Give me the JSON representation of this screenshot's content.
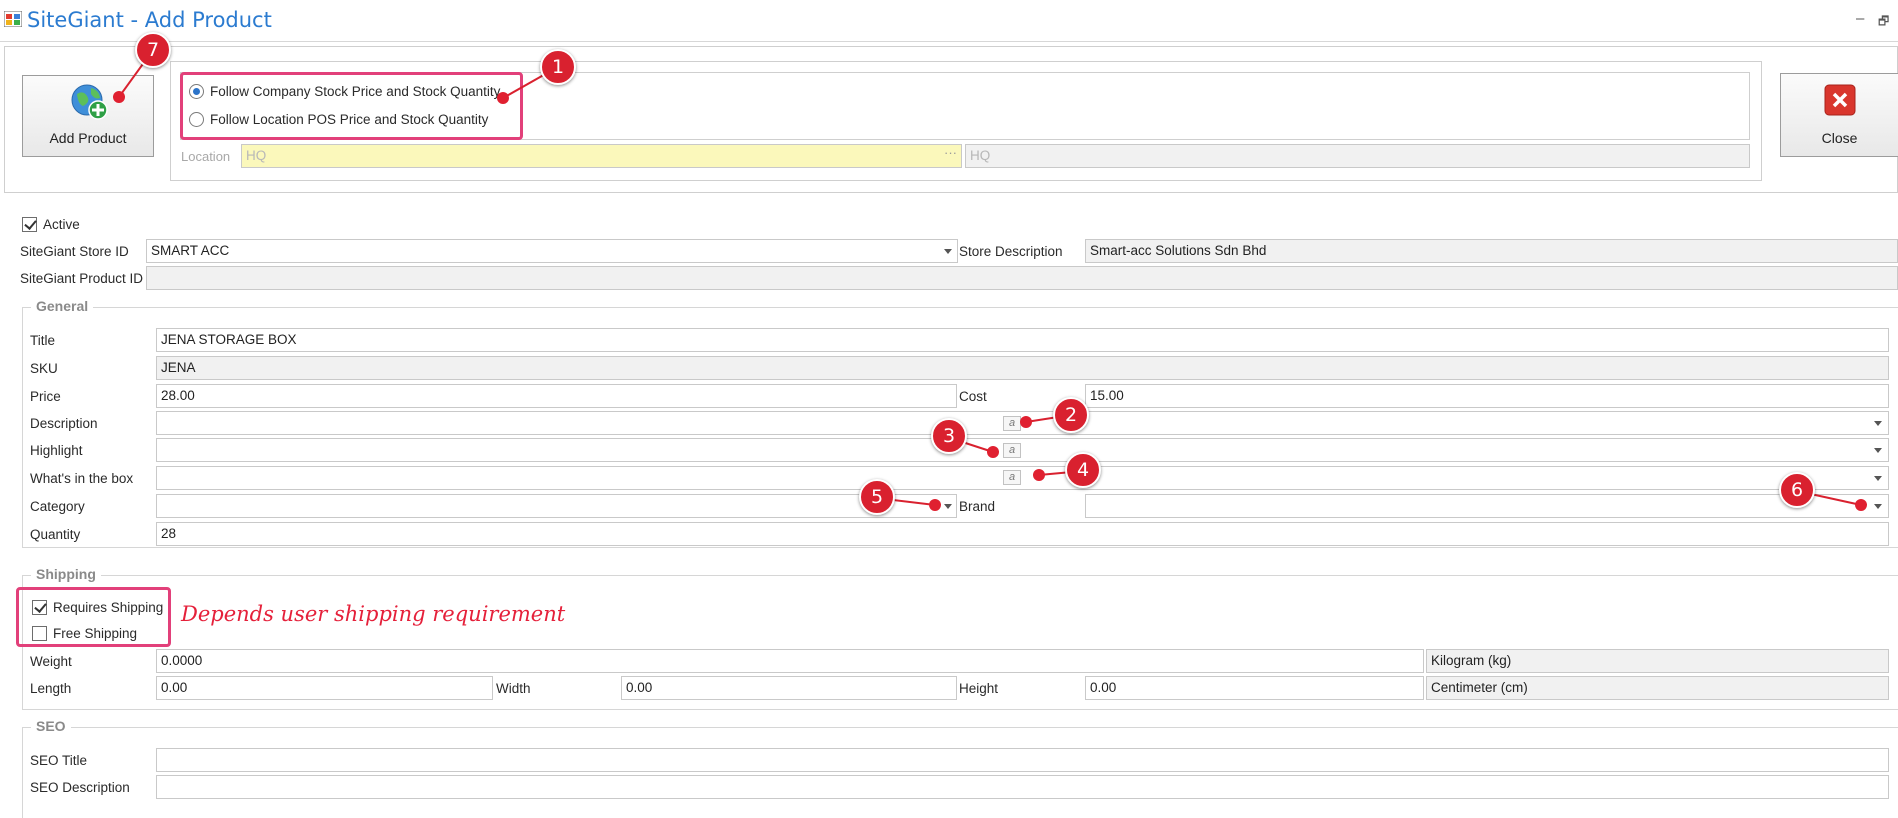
{
  "window": {
    "title": "SiteGiant - Add Product",
    "minimize_icon": "–",
    "restore_icon": "🗗"
  },
  "toolbar": {
    "add_product_label": "Add Product",
    "close_label": "Close",
    "options": [
      {
        "label": "Follow Company Stock Price and Stock Quantity",
        "selected": true
      },
      {
        "label": "Follow Location POS Price and Stock Quantity",
        "selected": false
      }
    ],
    "location_label": "Location",
    "location_value": "HQ",
    "location_desc": "HQ"
  },
  "store": {
    "active_label": "Active",
    "active_checked": true,
    "store_id_label": "SiteGiant Store ID",
    "store_id_value": "SMART ACC",
    "store_desc_label": "Store Description",
    "store_desc_value": "Smart-acc Solutions Sdn Bhd",
    "product_id_label": "SiteGiant Product ID",
    "product_id_value": ""
  },
  "general": {
    "group_title": "General",
    "title_label": "Title",
    "title_value": "JENA STORAGE BOX",
    "sku_label": "SKU",
    "sku_value": "JENA",
    "price_label": "Price",
    "price_value": "28.00",
    "cost_label": "Cost",
    "cost_value": "15.00",
    "description_label": "Description",
    "description_value": "",
    "highlight_label": "Highlight",
    "highlight_value": "",
    "whats_in_box_label": "What's in the box",
    "whats_in_box_value": "",
    "category_label": "Category",
    "category_value": "",
    "brand_label": "Brand",
    "brand_value": "",
    "quantity_label": "Quantity",
    "quantity_value": "28",
    "edit_glyph": "a"
  },
  "shipping": {
    "group_title": "Shipping",
    "requires_label": "Requires Shipping",
    "requires_checked": true,
    "free_label": "Free Shipping",
    "free_checked": false,
    "note": "Depends user shipping requirement",
    "weight_label": "Weight",
    "weight_value": "0.0000",
    "weight_unit": "Kilogram (kg)",
    "length_label": "Length",
    "length_value": "0.00",
    "width_label": "Width",
    "width_value": "0.00",
    "height_label": "Height",
    "height_value": "0.00",
    "dim_unit": "Centimeter (cm)"
  },
  "seo": {
    "group_title": "SEO",
    "title_label": "SEO Title",
    "title_value": "",
    "desc_label": "SEO Description",
    "desc_value": ""
  },
  "callouts": {
    "c1": "1",
    "c2": "2",
    "c3": "3",
    "c4": "4",
    "c5": "5",
    "c6": "6",
    "c7": "7"
  },
  "colors": {
    "callout": "#d9212f",
    "highlight": "#e2407a",
    "accent": "#2b7bd0"
  }
}
